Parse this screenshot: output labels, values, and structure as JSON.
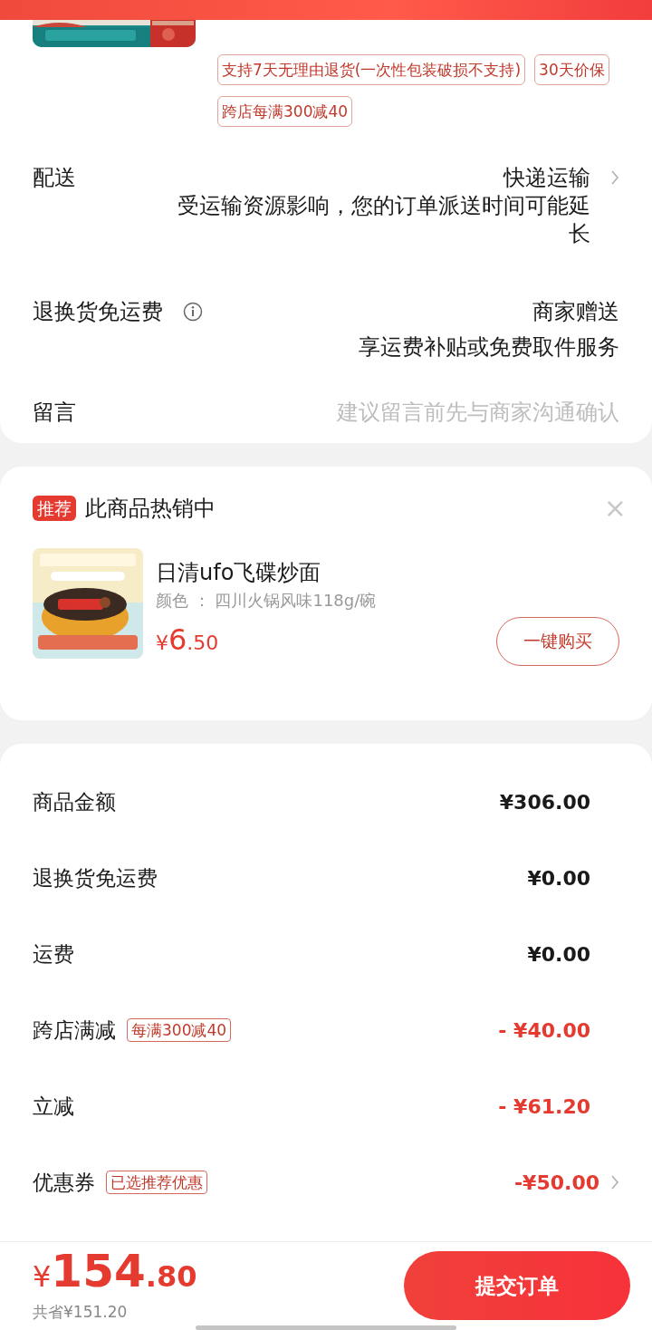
{
  "product": {
    "tags": [
      "支持7天无理由退货(一次性包装破损不支持)",
      "30天价保",
      "跨店每满300减40"
    ]
  },
  "delivery": {
    "label": "配送",
    "value": "快递运输",
    "note": "受运输资源影响，您的订单派送时间可能延长"
  },
  "return_shipping": {
    "label": "退换货免运费",
    "value": "商家赠送",
    "note": "享运费补贴或免费取件服务"
  },
  "message": {
    "label": "留言",
    "placeholder": "建议留言前先与商家沟通确认"
  },
  "recommendation": {
    "badge": "推荐",
    "title": "此商品热销中",
    "close": "×",
    "item": {
      "name": "日清ufo飞碟炒面",
      "spec": "颜色 ： 四川火锅风味118g/碗",
      "currency": "¥",
      "price_int": "6",
      "price_dec": ".50",
      "button": "一键购买"
    }
  },
  "summary": [
    {
      "kind": "plain",
      "label": "商品金额",
      "amount": "¥306.00"
    },
    {
      "kind": "plain",
      "label": "退换货免运费",
      "amount": "¥0.00"
    },
    {
      "kind": "plain",
      "label": "运费",
      "amount": "¥0.00"
    },
    {
      "kind": "discount",
      "label": "跨店满减",
      "tag": "每满300减40",
      "amount": "- ¥40.00"
    },
    {
      "kind": "discount",
      "label": "立减",
      "amount": "- ¥61.20"
    },
    {
      "kind": "link",
      "label": "优惠券",
      "tag": "已选推荐优惠",
      "amount": "-¥50.00"
    }
  ],
  "footer": {
    "currency": "¥",
    "total_int": "154",
    "total_dec": ".80",
    "saved": "共省¥151.20",
    "submit": "提交订单"
  }
}
